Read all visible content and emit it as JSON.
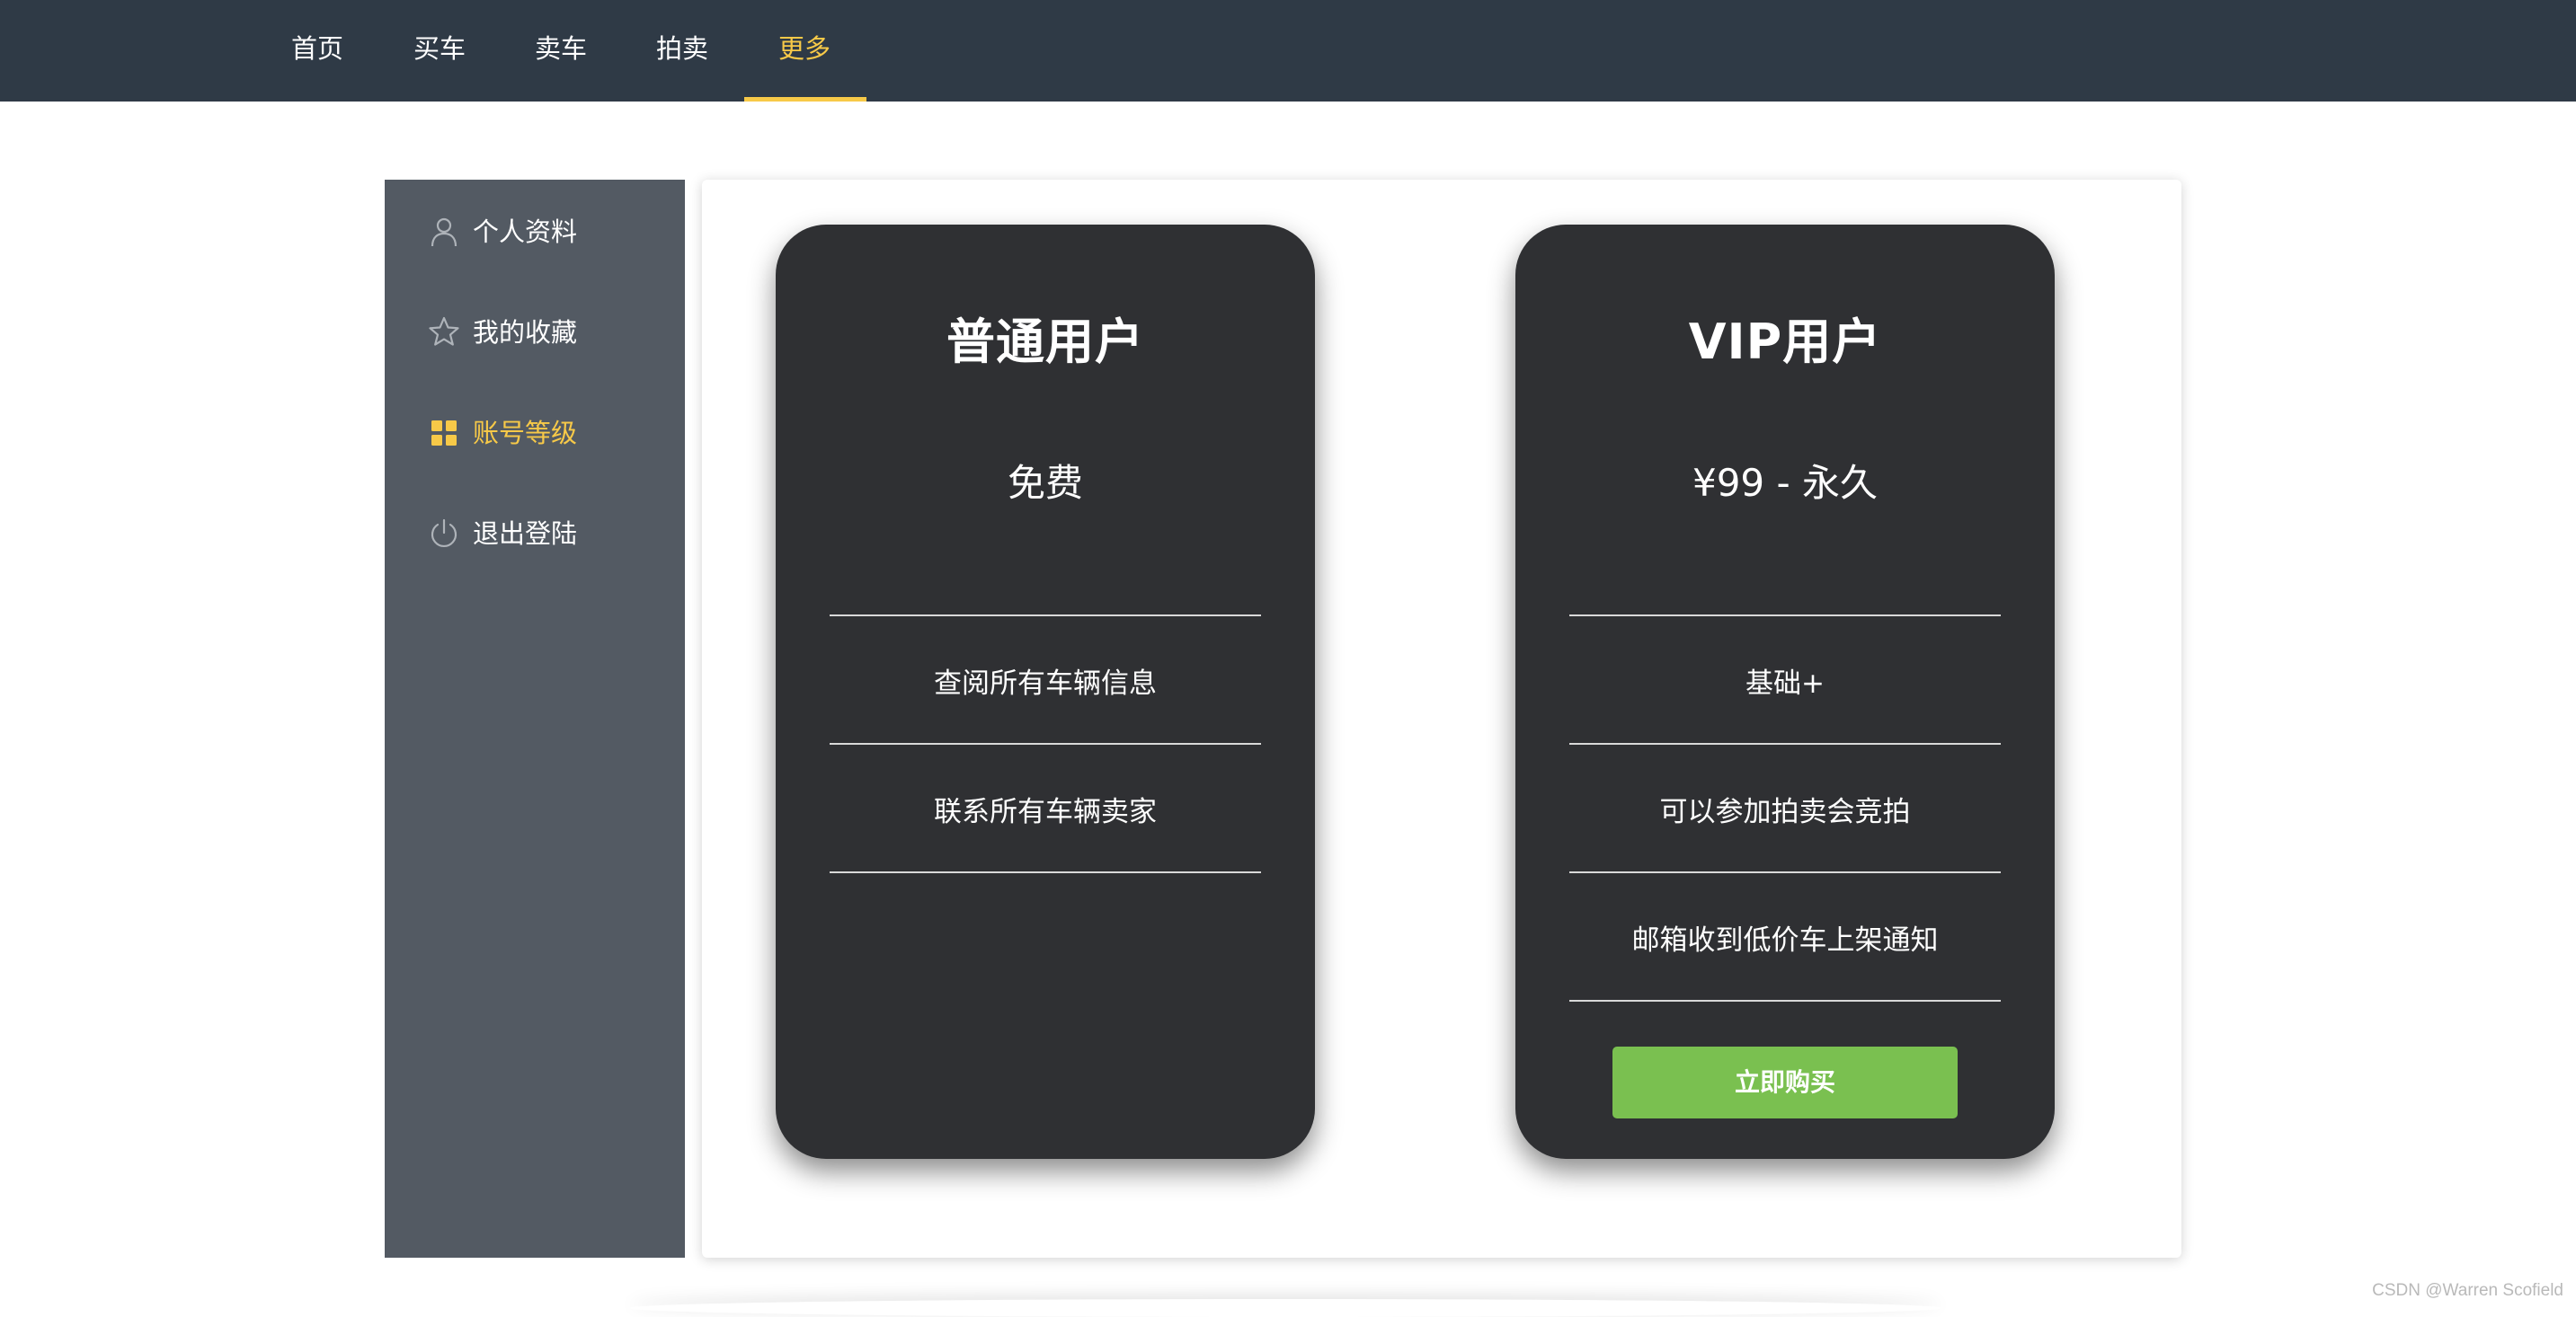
{
  "nav": {
    "items": [
      {
        "label": "首页"
      },
      {
        "label": "买车"
      },
      {
        "label": "卖车"
      },
      {
        "label": "拍卖"
      },
      {
        "label": "更多",
        "active": true
      }
    ]
  },
  "sidebar": {
    "items": [
      {
        "label": "个人资料",
        "icon": "user-icon"
      },
      {
        "label": "我的收藏",
        "icon": "star-icon"
      },
      {
        "label": "账号等级",
        "icon": "grid-icon",
        "active": true
      },
      {
        "label": "退出登陆",
        "icon": "power-icon"
      }
    ]
  },
  "plans": {
    "basic": {
      "title": "普通用户",
      "price": "免费",
      "features": [
        "查阅所有车辆信息",
        "联系所有车辆卖家"
      ]
    },
    "vip": {
      "title": "VIP用户",
      "price": "¥99 - 永久",
      "features": [
        "基础+",
        "可以参加拍卖会竞拍",
        "邮箱收到低价车上架通知"
      ],
      "buy_label": "立即购买"
    }
  },
  "watermark": "CSDN @Warren Scofield",
  "colors": {
    "nav_bg": "#2f3a46",
    "accent": "#f7c948",
    "sidebar_bg": "#535a63",
    "card_bg": "#2f3033",
    "buy_button": "#7ac050"
  }
}
